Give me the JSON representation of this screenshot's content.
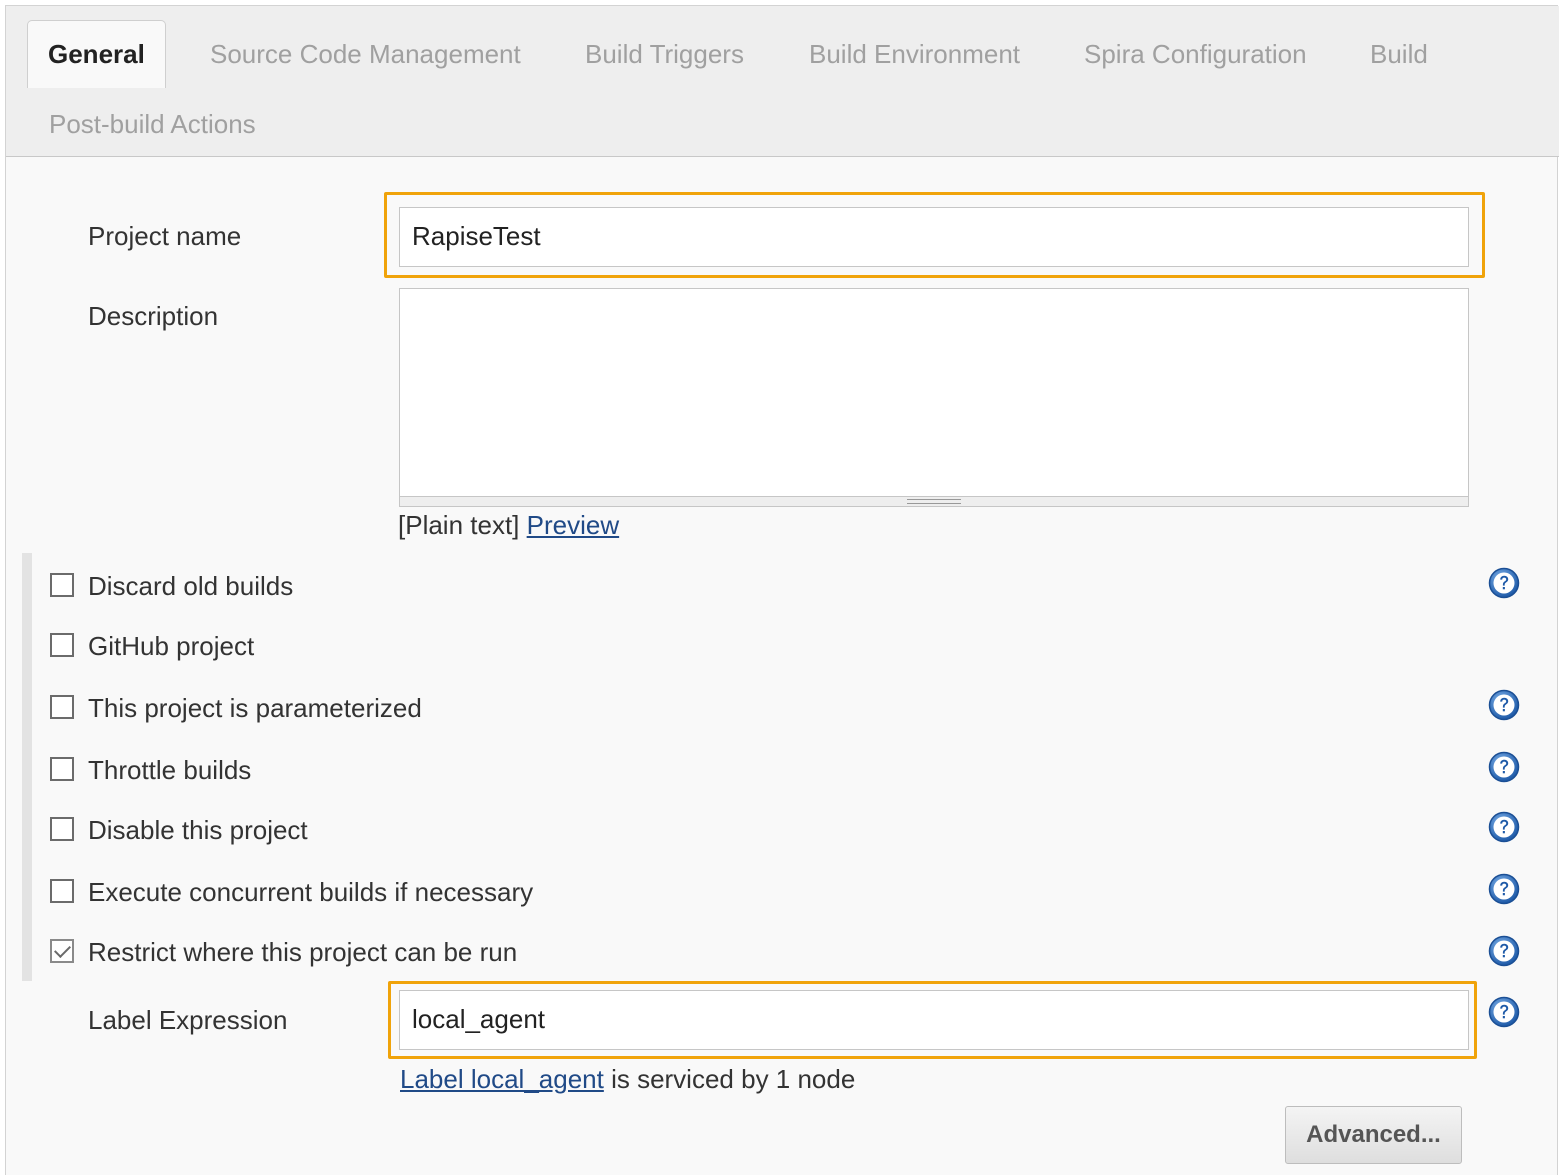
{
  "tabs": [
    {
      "label": "General",
      "active": true
    },
    {
      "label": "Source Code Management",
      "active": false
    },
    {
      "label": "Build Triggers",
      "active": false
    },
    {
      "label": "Build Environment",
      "active": false
    },
    {
      "label": "Spira Configuration",
      "active": false
    },
    {
      "label": "Build",
      "active": false
    },
    {
      "label": "Post-build Actions",
      "active": false
    }
  ],
  "project_name": {
    "label": "Project name",
    "value": "RapiseTest"
  },
  "description": {
    "label": "Description",
    "value": "",
    "format_text": "[Plain text]",
    "preview_link": "Preview"
  },
  "options": [
    {
      "label": "Discard old builds",
      "checked": false,
      "help": true
    },
    {
      "label": "GitHub project",
      "checked": false,
      "help": false
    },
    {
      "label": "This project is parameterized",
      "checked": false,
      "help": true
    },
    {
      "label": "Throttle builds",
      "checked": false,
      "help": true
    },
    {
      "label": "Disable this project",
      "checked": false,
      "help": true
    },
    {
      "label": "Execute concurrent builds if necessary",
      "checked": false,
      "help": true
    },
    {
      "label": "Restrict where this project can be run",
      "checked": true,
      "help": true
    }
  ],
  "label_expression": {
    "label": "Label Expression",
    "value": "local_agent",
    "status_link": "Label local_agent",
    "status_text": " is serviced by 1 node"
  },
  "advanced_button": "Advanced...",
  "colors": {
    "highlight": "#f0a30a",
    "link": "#204a87",
    "help_icon": "#1e5aa8"
  }
}
